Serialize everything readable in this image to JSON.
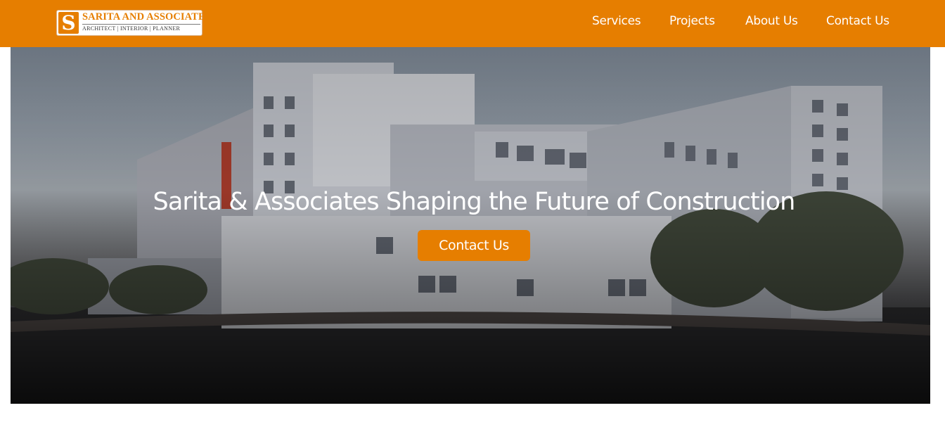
{
  "header": {
    "logo": {
      "mark": "S",
      "name": "SARITA AND ASSOCIATES",
      "tagline": "ARCHITECT | INTERIOR | PLANNER"
    },
    "nav": [
      {
        "label": "Services"
      },
      {
        "label": "Projects"
      },
      {
        "label": "About Us"
      },
      {
        "label": "Contact Us"
      }
    ]
  },
  "hero": {
    "title": "Sarita & Associates Shaping the Future of Construction",
    "cta_label": "Contact Us"
  },
  "colors": {
    "brand": "#e67e00",
    "header_text": "#ffffff",
    "page_background": "#ffffff"
  }
}
